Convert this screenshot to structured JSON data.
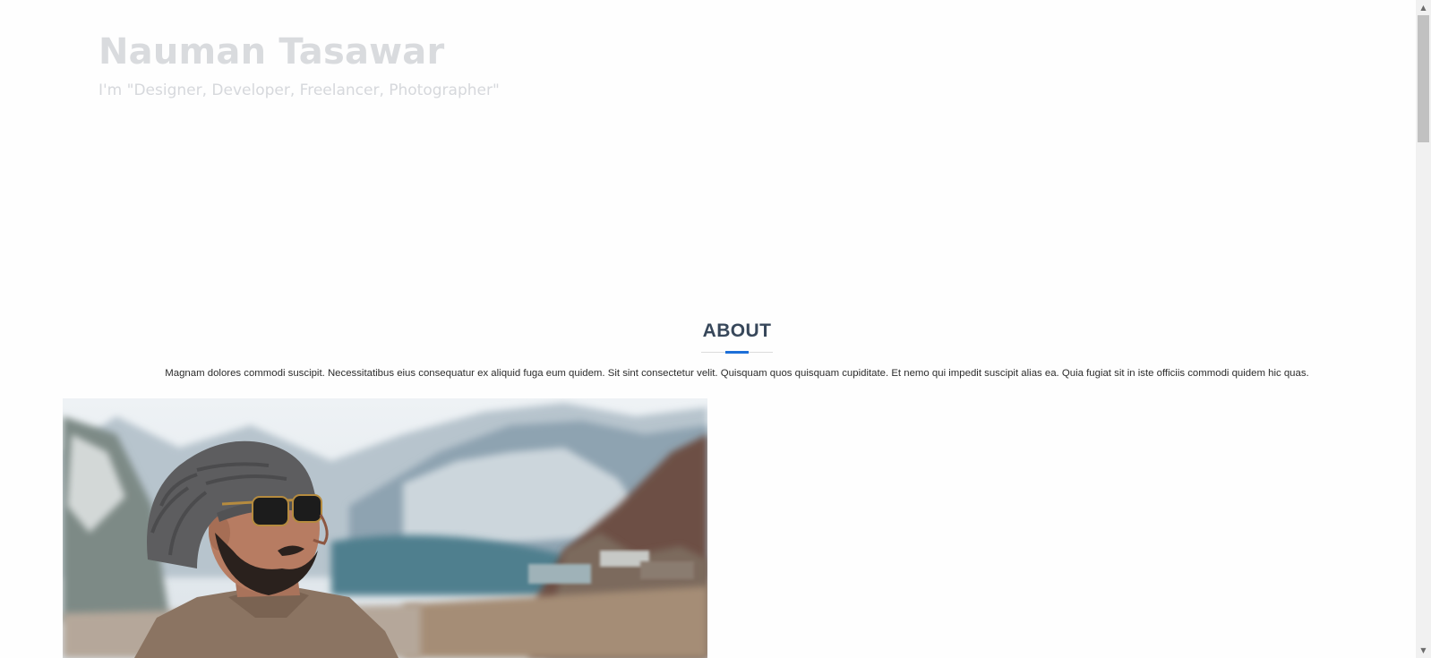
{
  "hero": {
    "name": "Nauman Tasawar",
    "tagline": "I'm \"Designer, Developer, Freelancer, Photographer\""
  },
  "about": {
    "title": "ABOUT",
    "text": "Magnam dolores commodi suscipit. Necessitatibus eius consequatur ex aliquid fuga eum quidem. Sit sint consectetur velit. Quisquam quos quisquam cupiditate. Et nemo qui impedit suscipit alias ea. Quia fugiat sit in iste officiis commodi quidem hic quas.",
    "accent_color": "#1d6fd8"
  },
  "scrollbar": {
    "up_icon": "triangle-up",
    "down_icon": "triangle-down"
  }
}
